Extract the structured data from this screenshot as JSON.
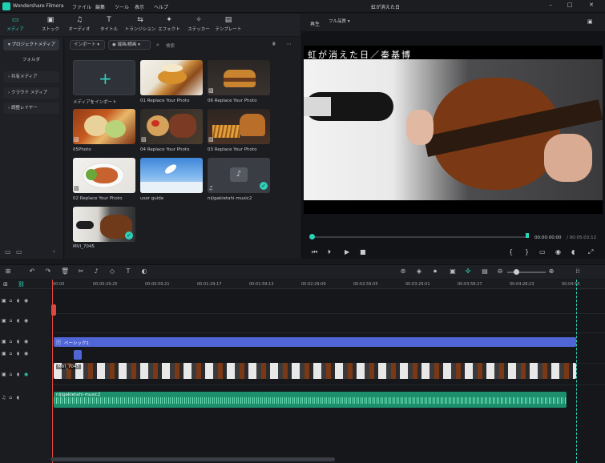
{
  "app": {
    "name": "Wondershare Filmora",
    "window_title": "虹が消えた日"
  },
  "menu": [
    "ファイル",
    "編集",
    "ツール",
    "表示",
    "ヘルプ"
  ],
  "tabs": [
    {
      "label": "メディア",
      "icon": "media-icon"
    },
    {
      "label": "ストック",
      "icon": "stock-icon"
    },
    {
      "label": "オーディオ",
      "icon": "audio-icon"
    },
    {
      "label": "タイトル",
      "icon": "title-icon"
    },
    {
      "label": "トランジション",
      "icon": "transition-icon"
    },
    {
      "label": "エフェクト",
      "icon": "effect-icon"
    },
    {
      "label": "ステッカー",
      "icon": "sticker-icon"
    },
    {
      "label": "テンプレート",
      "icon": "template-icon"
    }
  ],
  "sidebar": {
    "items": [
      {
        "label": "プロジェクトメディア"
      },
      {
        "label": "フォルダ"
      },
      {
        "label": "共有メディア"
      },
      {
        "label": "クラウド メディア"
      },
      {
        "label": "調整レイヤー"
      }
    ]
  },
  "media_toolbar": {
    "import": "インポート",
    "sort": "縦画/横画",
    "search_placeholder": "検索"
  },
  "media_items": [
    {
      "caption": "メディアをインポート"
    },
    {
      "caption": "01 Replace Your Photo"
    },
    {
      "caption": "06 Replace Your Photo"
    },
    {
      "caption": "05Photo"
    },
    {
      "caption": "04 Replace Your Photo"
    },
    {
      "caption": "03 Replace Your Photo"
    },
    {
      "caption": "02 Replace Your Photo"
    },
    {
      "caption": "user guide"
    },
    {
      "caption": "nijigakietahi-music2"
    },
    {
      "caption": "MVI_7045"
    }
  ],
  "preview": {
    "play_label": "再生",
    "quality": "フル品質",
    "overlay_text": "虹が消えた日／秦基博",
    "timecode_current": "00:00:00:00",
    "timecode_total": "/ 00:05:03:12"
  },
  "ruler": [
    "00:00",
    "00:00:29:25",
    "00:00:59:21",
    "00:01:29:17",
    "00:01:59:13",
    "00:02:29:09",
    "00:02:59:05",
    "00:03:29:01",
    "00:03:58:27",
    "00:04:28:23",
    "00:04:58"
  ],
  "timeline": {
    "title_clip": "ベーシック1",
    "video_clip": "MVI_7045",
    "audio_clip": "nijigakietahi-music2"
  },
  "colors": {
    "accent": "#2fd0b8",
    "title_clip": "#5066d6",
    "audio_clip": "#1d8f6c",
    "playhead": "#e0483e"
  }
}
